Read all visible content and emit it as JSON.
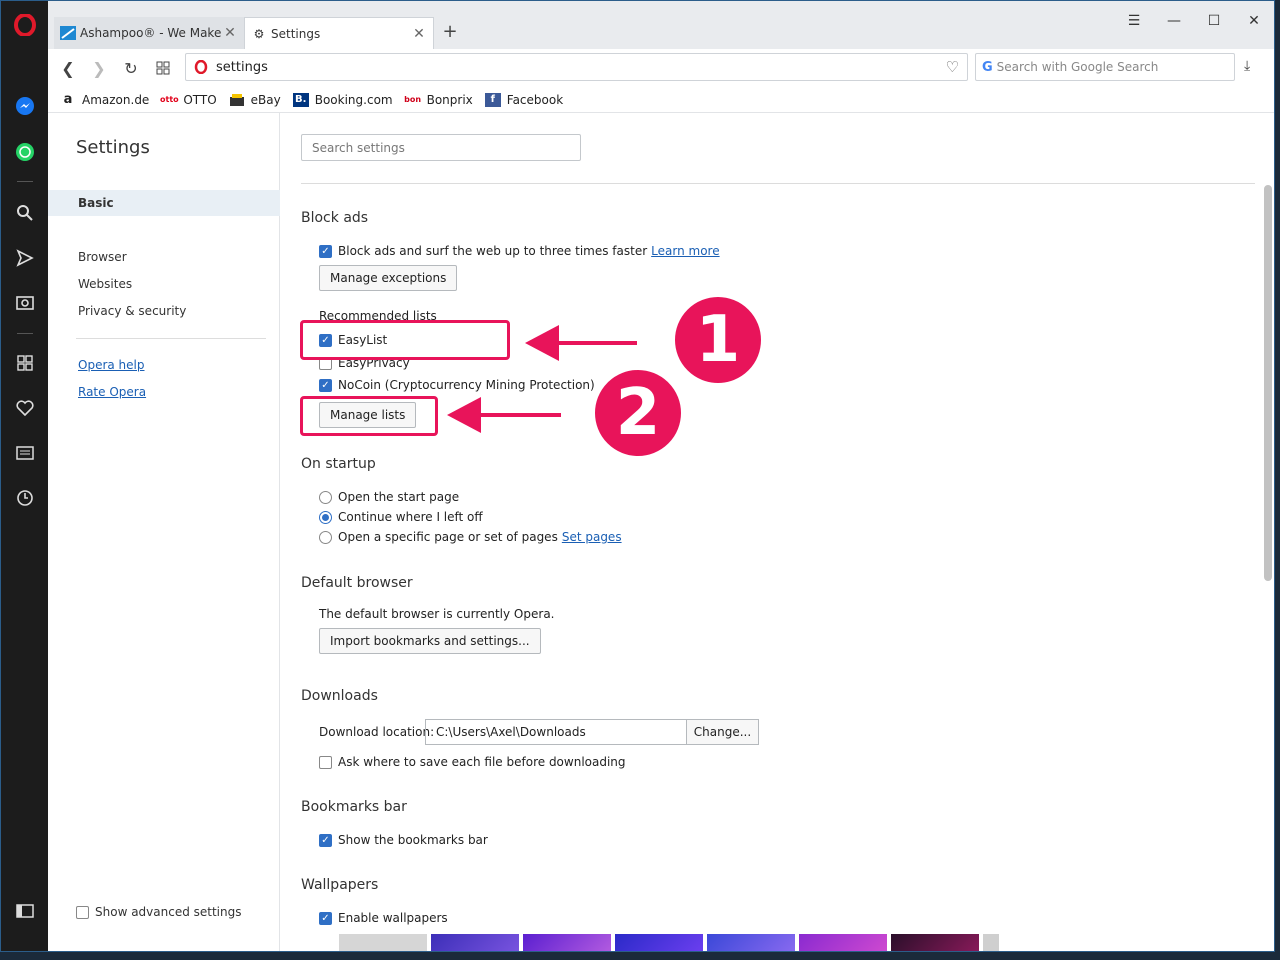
{
  "tabs": [
    {
      "label": "Ashampoo® - We Make S",
      "active": false
    },
    {
      "label": "Settings",
      "active": true
    }
  ],
  "address": {
    "url": "settings"
  },
  "search": {
    "placeholder": "Search with Google Search"
  },
  "bookmarks": [
    "Amazon.de",
    "OTTO",
    "eBay",
    "Booking.com",
    "Bonprix",
    "Facebook"
  ],
  "nav": {
    "title": "Settings",
    "items": [
      "Basic",
      "Browser",
      "Websites",
      "Privacy & security"
    ],
    "links": [
      "Opera help",
      "Rate Opera"
    ],
    "advanced": "Show advanced settings"
  },
  "settings_search": {
    "placeholder": "Search settings"
  },
  "block_ads": {
    "heading": "Block ads",
    "main_checkbox": "Block ads and surf the web up to three times faster",
    "learn_more": "Learn more",
    "manage_exceptions": "Manage exceptions",
    "recommended_title": "Recommended lists",
    "lists": [
      {
        "label": "EasyList",
        "checked": true
      },
      {
        "label": "EasyPrivacy",
        "checked": false
      },
      {
        "label": "NoCoin (Cryptocurrency Mining Protection)",
        "checked": true
      }
    ],
    "manage_lists": "Manage lists"
  },
  "startup": {
    "heading": "On startup",
    "options": [
      "Open the start page",
      "Continue where I left off",
      "Open a specific page or set of pages"
    ],
    "selected_index": 1,
    "set_pages": "Set pages"
  },
  "default_browser": {
    "heading": "Default browser",
    "status": "The default browser is currently Opera.",
    "import_button": "Import bookmarks and settings..."
  },
  "downloads": {
    "heading": "Downloads",
    "location_label": "Download location:",
    "location_value": "C:\\Users\\Axel\\Downloads",
    "change_button": "Change...",
    "ask_checkbox": "Ask where to save each file before downloading"
  },
  "bookmarks_bar": {
    "heading": "Bookmarks bar",
    "checkbox": "Show the bookmarks bar"
  },
  "wallpapers": {
    "heading": "Wallpapers",
    "checkbox": "Enable wallpapers"
  },
  "annotations": {
    "badge1": "1",
    "badge2": "2"
  },
  "colors": {
    "accent": "#2f6fc5",
    "annotation": "#e8145a"
  }
}
